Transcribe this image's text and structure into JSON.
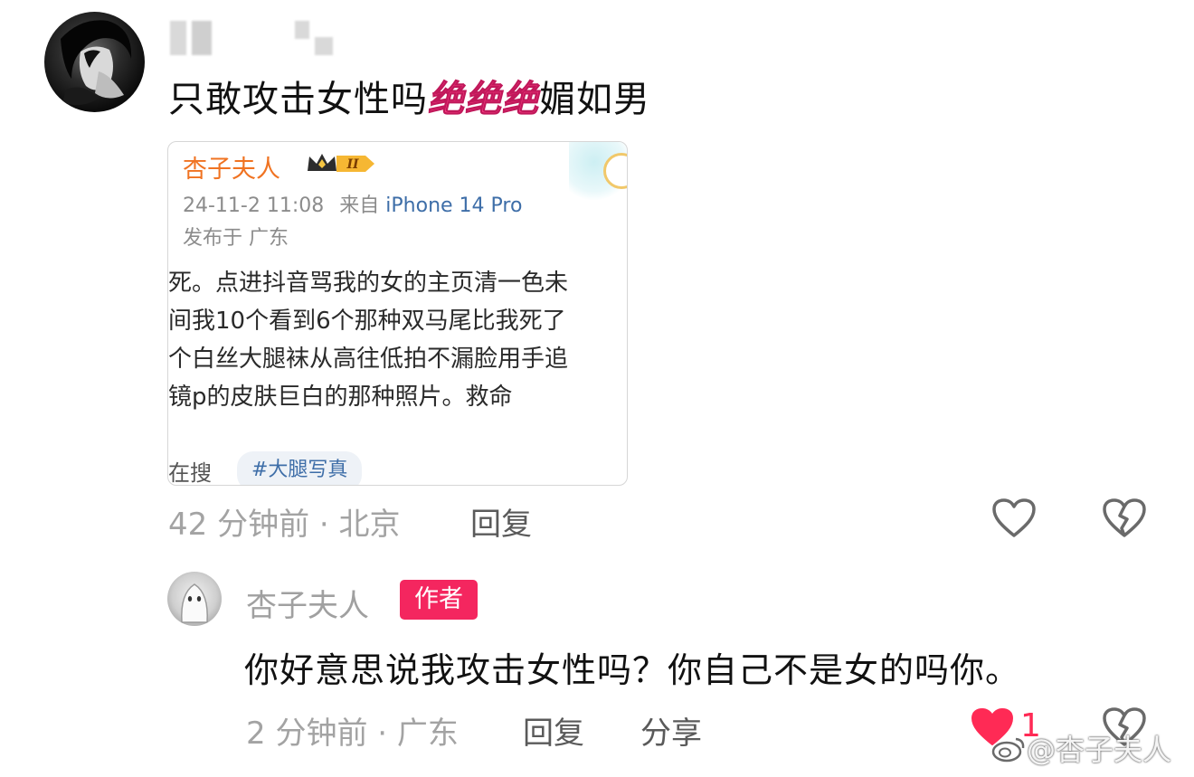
{
  "comment": {
    "text_before": "只敢攻击女性吗",
    "emphasis": [
      "绝",
      "绝",
      "绝"
    ],
    "text_after": "媚如男",
    "time_location": "42 分钟前 · 北京",
    "reply_label": "回复"
  },
  "quoted_post": {
    "username": "杏子夫人",
    "level_badge": "II",
    "time": "24-11-2 11:08",
    "from_prefix": "来自",
    "device": "iPhone 14 Pro",
    "published_in": "发布于 广东",
    "body_lines": [
      "死。点进抖音骂我的女的主页清一色未",
      "间我10个看到6个那种双马尾比我死了",
      "个白丝大腿袜从高往低拍不漏脸用手追",
      "镜p的皮肤巨白的那种照片。救命"
    ],
    "search_label": "在搜",
    "hashtag": "#大腿写真"
  },
  "reply": {
    "username": "杏子夫人",
    "badge": "作者",
    "text": "你好意思说我攻击女性吗？你自己不是女的吗你。",
    "time_location": "2 分钟前 · 广东",
    "reply_label": "回复",
    "share_label": "分享",
    "like_count": "1"
  },
  "watermark": "@杏子夫人",
  "colors": {
    "accent_pink": "#ff3d86",
    "author_badge": "#f4265f",
    "liked_heart": "#ff2a55",
    "quoted_username": "#f07322",
    "link_blue": "#3e6ea8"
  }
}
